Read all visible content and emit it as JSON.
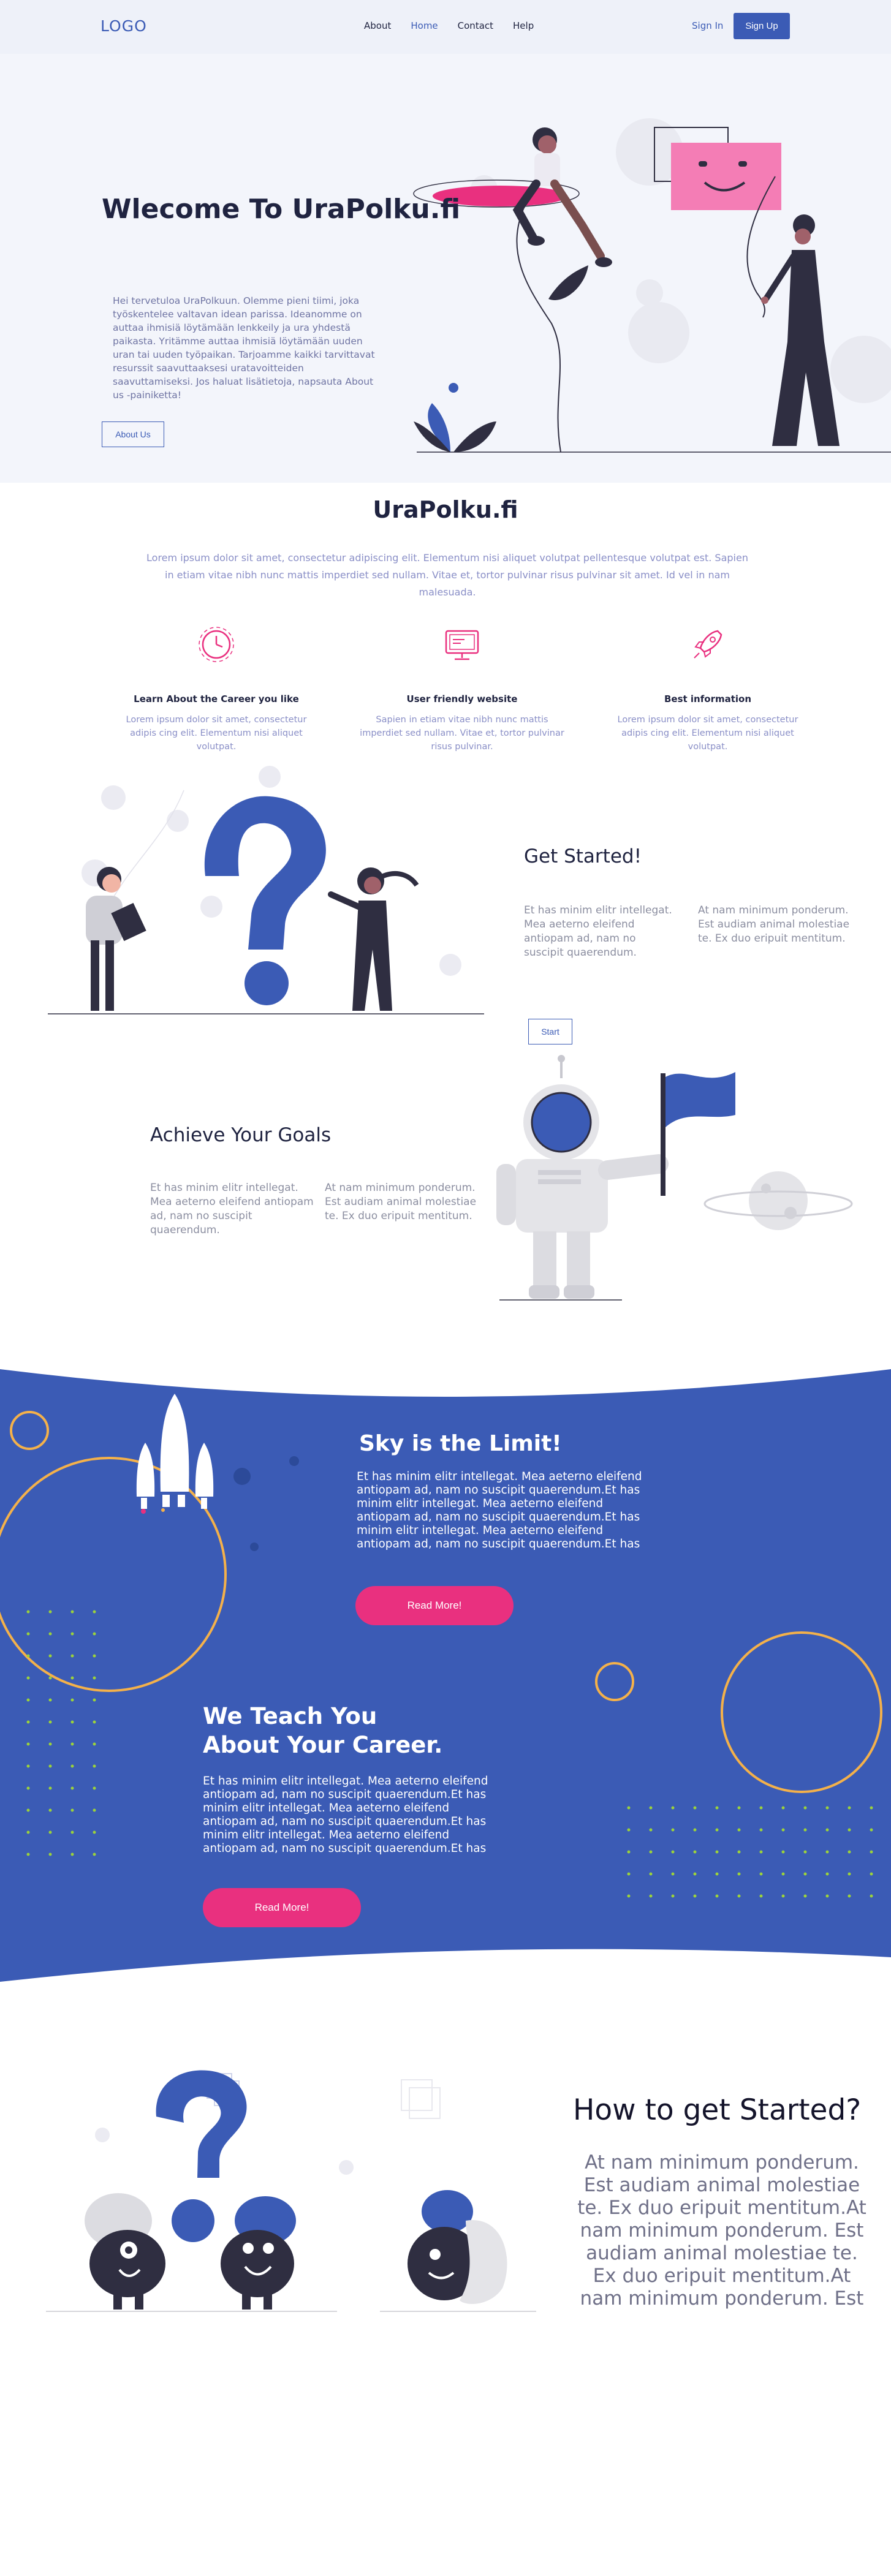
{
  "nav": {
    "logo": "LOGO",
    "links": [
      "About",
      "Home",
      "Contact",
      "Help"
    ],
    "active": "Home",
    "sign_in": "Sign In",
    "sign_up": "Sign Up"
  },
  "hero": {
    "title": "Wlecome To UraPolku.fi",
    "text": "Hei tervetuloa UraPolkuun. Olemme pieni tiimi, joka työskentelee valtavan idean parissa. Ideanomme on auttaa ihmisiä löytämään lenkkeily ja ura yhdestä paikasta. Yritämme auttaa ihmisiä löytämään uuden uran tai uuden työpaikan. Tarjoamme kaikki tarvittavat resurssit saavuttaaksesi uratavoitteiden saavuttamiseksi. Jos haluat lisätietoja, napsauta About us -painiketta!",
    "button": "About Us"
  },
  "intro": {
    "title": "UraPolku.fi",
    "text": "Lorem ipsum dolor sit amet, consectetur adipiscing elit. Elementum nisi aliquet volutpat pellentesque volutpat est. Sapien in etiam vitae nibh nunc mattis imperdiet sed nullam. Vitae et, tortor pulvinar risus pulvinar sit amet. Id vel in nam malesuada."
  },
  "features": [
    {
      "icon": "clock-icon",
      "title": "Learn About the Career you like",
      "text": "Lorem ipsum dolor sit amet, consectetur adipis cing elit. Elementum nisi aliquet volutpat."
    },
    {
      "icon": "monitor-icon",
      "title": "User friendly  website",
      "text": "Sapien in etiam vitae nibh nunc mattis imperdiet sed nullam. Vitae et, tortor pulvinar risus pulvinar."
    },
    {
      "icon": "rocket-icon",
      "title": "Best information",
      "text": "Lorem ipsum dolor sit amet, consectetur adipis cing elit. Elementum nisi aliquet volutpat."
    }
  ],
  "get_started": {
    "title": "Get Started!",
    "col1": "Et has minim elitr intellegat. Mea aeterno eleifend antiopam ad, nam no suscipit quaerendum.",
    "col2": "At nam minimum ponderum. Est audiam animal molestiae te. Ex duo eripuit mentitum.",
    "button": "Start"
  },
  "achieve": {
    "title": "Achieve Your Goals",
    "col1": "Et has minim elitr intellegat. Mea aeterno eleifend antiopam ad, nam no suscipit quaerendum.",
    "col2": "At nam minimum ponderum. Est audiam animal molestiae te. Ex duo eripuit mentitum."
  },
  "sky": {
    "title": "Sky is the Limit!",
    "text": "Et has minim elitr intellegat. Mea aeterno eleifend antiopam ad, nam no suscipit quaerendum.Et has minim elitr intellegat. Mea aeterno eleifend antiopam ad, nam no suscipit quaerendum.Et has minim elitr intellegat. Mea aeterno eleifend antiopam ad, nam no suscipit quaerendum.Et has",
    "button": "Read More!"
  },
  "teach": {
    "title": "We Teach You About Your Career.",
    "text": "Et has minim elitr intellegat. Mea aeterno eleifend antiopam ad, nam no suscipit quaerendum.Et has minim elitr intellegat. Mea aeterno eleifend antiopam ad, nam no suscipit quaerendum.Et has minim elitr intellegat. Mea aeterno eleifend antiopam ad, nam no suscipit quaerendum.Et has",
    "button": "Read More!"
  },
  "how": {
    "title": "How to get Started?",
    "text": "At nam minimum ponderum. Est audiam animal molestiae te. Ex duo eripuit mentitum.At nam minimum ponderum. Est audiam animal molestiae te. Ex duo eripuit mentitum.At nam minimum ponderum. Est"
  },
  "colors": {
    "brand_blue": "#3b5bb5",
    "pink": "#e9307f",
    "dark": "#1f2340",
    "orange": "#f4b14a",
    "green_dots": "#9bd23b"
  }
}
